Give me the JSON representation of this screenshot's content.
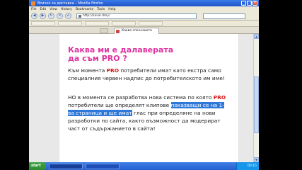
{
  "window": {
    "title": "Всичко за доставка – Mozilla Firefox",
    "controls": [
      "_",
      "□",
      "×"
    ]
  },
  "menu": [
    "File",
    "Edit",
    "View",
    "History",
    "Bookmarks",
    "Tools",
    "Help"
  ],
  "nav": {
    "back_icon": "back-arrow-icon",
    "forward_icon": "forward-arrow-icon",
    "reload_icon": "reload-icon",
    "url": "http://kaval.dmy/"
  },
  "tab": {
    "label": "Какво спечелихте"
  },
  "article": {
    "headline": "Каква ми е далаверата да съм PRO ?",
    "p1_part1": "Към момента ",
    "p1_pro": "PRO",
    "p1_part2": " потребители имат като екстра само специалния червен надпис до потребителското им име!",
    "p2_part1": "НО в момента се разработва нова система по която ",
    "p2_pro": "PRO",
    "p2_part2": " потребители ще определят клипове ",
    "p2_selected": "показващи се на 1-ва страница и ще имат",
    "p2_part3": " глас при определяне на нови разработки по сайта, както възможност да модерират част от съдържанието в сайта!"
  },
  "taskbar": {
    "start_label": "start",
    "clock": "00:15"
  },
  "colors": {
    "headline": "#e0339f",
    "pro": "#d41212",
    "selection": "#2f78d8",
    "titlebar": "#1f52c9"
  }
}
